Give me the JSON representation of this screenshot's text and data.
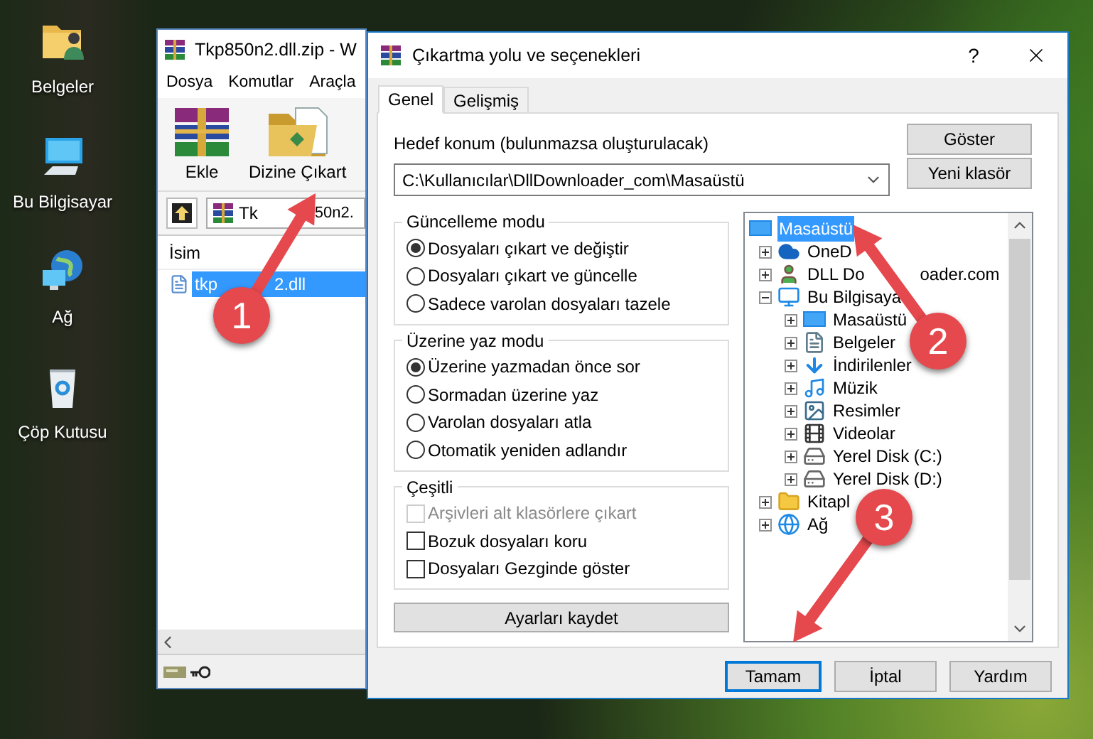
{
  "desktop_icons": [
    {
      "label": "Belgeler",
      "kind": "documents"
    },
    {
      "label": "Bu Bilgisayar",
      "kind": "computer"
    },
    {
      "label": "Ağ",
      "kind": "network"
    },
    {
      "label": "Çöp Kutusu",
      "kind": "recycle"
    }
  ],
  "archive_window": {
    "title": "Tkp850n2.dll.zip - W",
    "menu": [
      "Dosya",
      "Komutlar",
      "Araçla"
    ],
    "toolbar": [
      {
        "label": "Ekle",
        "kind": "add"
      },
      {
        "label": "Dizine Çıkart",
        "kind": "extract"
      }
    ],
    "path": "Tk",
    "path_after": "50n2.",
    "column": "İsim",
    "files": [
      {
        "name": "tkp",
        "name_after": "2.dll",
        "selected": true
      }
    ]
  },
  "dialog": {
    "title": "Çıkartma yolu ve seçenekleri",
    "help": "?",
    "tabs": [
      {
        "label": "Genel",
        "selected": true
      },
      {
        "label": "Gelişmiş",
        "selected": false
      }
    ],
    "destination": {
      "label": "Hedef konum (bulunmazsa oluşturulacak)",
      "value": "C:\\Kullanıcılar\\DllDownloader_com\\Masaüstü"
    },
    "side_buttons": [
      "Göster",
      "Yeni klasör"
    ],
    "groups": [
      {
        "title": "Güncelleme modu",
        "kind": "radio",
        "options": [
          {
            "label": "Dosyaları çıkart ve değiştir",
            "selected": true
          },
          {
            "label": "Dosyaları çıkart ve güncelle",
            "selected": false
          },
          {
            "label": "Sadece varolan dosyaları tazele",
            "selected": false
          }
        ]
      },
      {
        "title": "Üzerine yaz modu",
        "kind": "radio",
        "options": [
          {
            "label": "Üzerine yazmadan önce sor",
            "selected": true
          },
          {
            "label": "Sormadan üzerine yaz",
            "selected": false
          },
          {
            "label": "Varolan dosyaları atla",
            "selected": false
          },
          {
            "label": "Otomatik yeniden adlandır",
            "selected": false
          }
        ]
      },
      {
        "title": "Çeşitli",
        "kind": "checkbox",
        "options": [
          {
            "label": "Arşivleri alt klasörlere çıkart",
            "checked": false,
            "disabled": true
          },
          {
            "label": "Bozuk dosyaları koru",
            "checked": false,
            "disabled": false
          },
          {
            "label": "Dosyaları Gezginde göster",
            "checked": false,
            "disabled": false
          }
        ]
      }
    ],
    "save_button": "Ayarları kaydet",
    "tree": [
      {
        "label": "Masaüstü",
        "kind": "desktop",
        "selected": true,
        "children": [
          {
            "label": "OneD",
            "kind": "cloud",
            "selected": false,
            "expanded": false
          },
          {
            "label": "DLL Do",
            "label_after": "oader.com",
            "kind": "user",
            "selected": false,
            "expanded": false
          },
          {
            "label": "Bu Bilgisaya",
            "kind": "computer",
            "selected": false,
            "expanded": true,
            "children": [
              {
                "label": "Masaüstü",
                "kind": "desktop",
                "selected": false,
                "expanded": false
              },
              {
                "label": "Belgeler",
                "kind": "documents",
                "selected": false,
                "expanded": false
              },
              {
                "label": "İndirilenler",
                "kind": "downloads",
                "selected": false,
                "expanded": false
              },
              {
                "label": "Müzik",
                "kind": "music",
                "selected": false,
                "expanded": false
              },
              {
                "label": "Resimler",
                "kind": "pictures",
                "selected": false,
                "expanded": false
              },
              {
                "label": "Videolar",
                "kind": "videos",
                "selected": false,
                "expanded": false
              },
              {
                "label": "Yerel Disk (C:)",
                "kind": "disk",
                "selected": false,
                "expanded": false
              },
              {
                "label": "Yerel Disk (D:)",
                "kind": "disk",
                "selected": false,
                "expanded": false
              }
            ]
          },
          {
            "label": "Kitapl",
            "kind": "libraries",
            "selected": false,
            "expanded": false
          },
          {
            "label": "Ağ",
            "kind": "network",
            "selected": false,
            "expanded": false
          }
        ]
      }
    ],
    "buttons": [
      {
        "label": "Tamam",
        "focused": true
      },
      {
        "label": "İptal",
        "focused": false
      },
      {
        "label": "Yardım",
        "focused": false
      }
    ]
  },
  "annotations": [
    {
      "label": "1"
    },
    {
      "label": "2"
    },
    {
      "label": "3"
    }
  ]
}
